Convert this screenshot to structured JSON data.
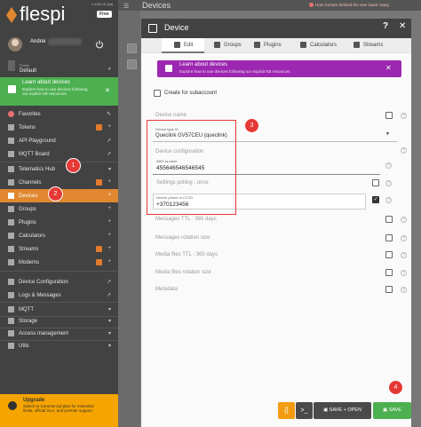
{
  "sidebar": {
    "brand": "flespi",
    "version": "v.4.65.15 (ea)",
    "plan_badge": "Free",
    "user_name": "Andrei",
    "profile_label": "Profile",
    "profile_value": "Default",
    "learn": {
      "title": "Learn about devices",
      "desc": "Explore how to use devices following our explicit KB resources"
    },
    "items": [
      {
        "label": "Favorites"
      },
      {
        "label": "Tokens"
      },
      {
        "label": "API Playground"
      },
      {
        "label": "MQTT Board"
      },
      {
        "label": "Telematics Hub"
      },
      {
        "label": "Channels"
      },
      {
        "label": "Devices"
      },
      {
        "label": "Groups"
      },
      {
        "label": "Plugins"
      },
      {
        "label": "Calculators"
      },
      {
        "label": "Streams"
      },
      {
        "label": "Modems"
      },
      {
        "label": "Device Configuration"
      },
      {
        "label": "Logs & Messages"
      },
      {
        "label": "MQTT"
      },
      {
        "label": "Storage"
      },
      {
        "label": "Access management"
      },
      {
        "label": "Utils"
      }
    ],
    "upgrade": {
      "title": "Upgrade",
      "desc": "Switch to Commercial plan for extended limits, official SLA, and premier support"
    }
  },
  "topbar": {
    "title": "Devices",
    "news": "How Gurtam defined the new SaaS categ"
  },
  "dialog": {
    "title": "Device",
    "tabs": [
      "Edit",
      "Groups",
      "Plugins",
      "Calculators",
      "Streams"
    ],
    "learn": {
      "title": "Learn about devices",
      "desc": "Explore how to use devices following our explicit KB resources"
    },
    "create_subaccount": "Create for subaccount",
    "device_name": "Device name",
    "device_type_label": "Device type ID",
    "device_type_value": "Queclink GV57CEU (queclink)",
    "device_config": "Device configuration",
    "imei_label": "IMEI as ident",
    "imei_value": "455646546546545",
    "settings_polling": "Settings polling : once",
    "phone_label": "Device phone or ICCID",
    "phone_value": "+370123456",
    "messages_ttl": "Messages TTL : 365 days",
    "messages_rotation": "Messages rotation size",
    "media_ttl": "Media files TTL : 365 days",
    "media_rotation": "Media files rotation size",
    "metadata": "Metadata",
    "btn_save_open": "SAVE + OPEN",
    "btn_save": "SAVE"
  },
  "annotations": [
    "1",
    "2",
    "3",
    "4"
  ]
}
